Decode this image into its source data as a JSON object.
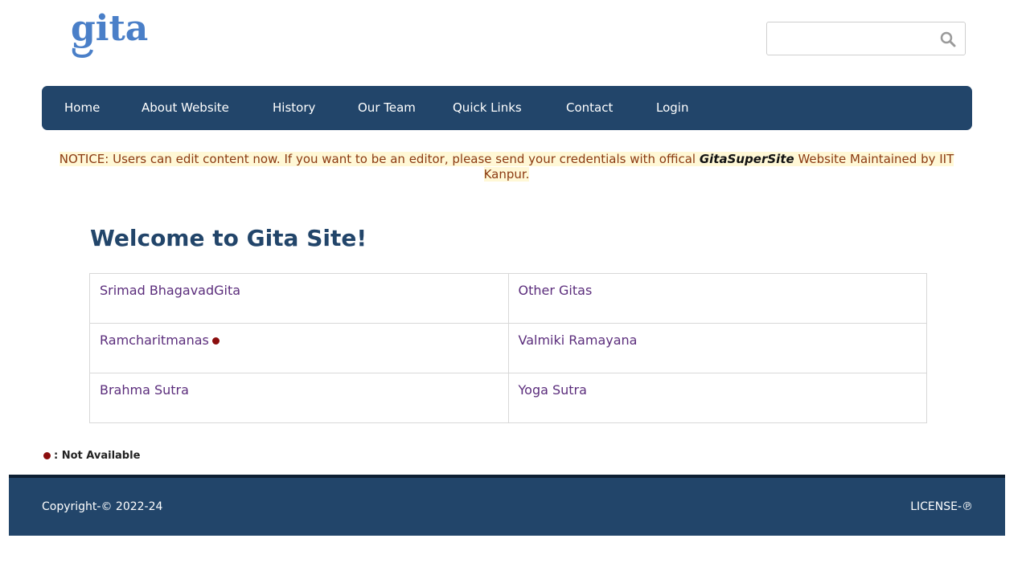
{
  "logo": {
    "text": "gita",
    "color": "#4a7fc8"
  },
  "search": {
    "placeholder": "",
    "value": "",
    "icon": "search-icon"
  },
  "nav": {
    "items": [
      "Home",
      "About Website",
      "History",
      "Our Team",
      "Quick Links",
      "Contact",
      "Login"
    ]
  },
  "notice": {
    "prefix": "NOTICE: Users can edit content now. If you want to be an editor, please send your credentials with offical ",
    "bold": "GitaSuperSite",
    "suffix": " Website Maintained by IIT Kanpur."
  },
  "heading": "Welcome to Gita Site!",
  "texts": {
    "rows": [
      [
        {
          "label": "Srimad BhagavadGita",
          "unavailable": false
        },
        {
          "label": "Other Gitas",
          "unavailable": false
        }
      ],
      [
        {
          "label": "Ramcharitmanas",
          "unavailable": true
        },
        {
          "label": "Valmiki Ramayana",
          "unavailable": false
        }
      ],
      [
        {
          "label": "Brahma Sutra",
          "unavailable": false
        },
        {
          "label": "Yoga Sutra",
          "unavailable": false
        }
      ]
    ]
  },
  "legend": {
    "text": ": Not Available",
    "dot_color": "#8b0e0e"
  },
  "footer": {
    "copyright": "Copyright-© 2022-24",
    "license": "LICENSE-℗"
  },
  "colors": {
    "brand": "#22456a",
    "link": "#5b2d7c",
    "notice": "#8b3a12"
  }
}
